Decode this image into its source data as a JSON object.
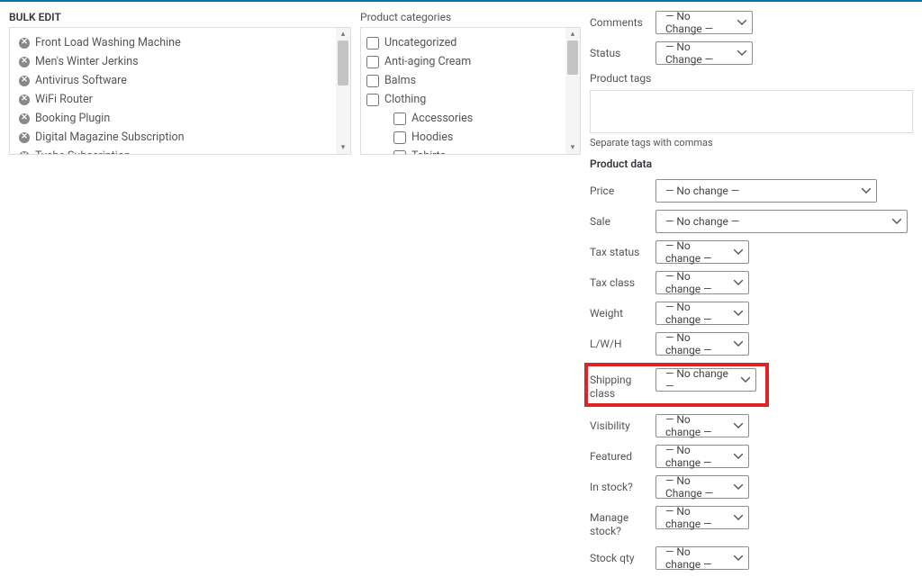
{
  "bulkEdit": {
    "title": "BULK EDIT",
    "items": [
      "Front Load Washing Machine",
      "Men's Winter Jerkins",
      "Antivirus Software",
      "WiFi Router",
      "Booking Plugin",
      "Digital Magazine Subscription",
      "Tyche Subscription"
    ]
  },
  "categories": {
    "title": "Product categories",
    "items": [
      {
        "label": "Uncategorized",
        "level": 0
      },
      {
        "label": "Anti-aging Cream",
        "level": 0
      },
      {
        "label": "Balms",
        "level": 0
      },
      {
        "label": "Clothing",
        "level": 0
      },
      {
        "label": "Accessories",
        "level": 1
      },
      {
        "label": "Hoodies",
        "level": 1
      },
      {
        "label": "Tshirts",
        "level": 1
      }
    ]
  },
  "right": {
    "comments": {
      "label": "Comments",
      "value": "— No Change —"
    },
    "status": {
      "label": "Status",
      "value": "— No Change —"
    },
    "tags": {
      "label": "Product tags",
      "hint": "Separate tags with commas"
    },
    "productData": {
      "label": "Product data"
    },
    "price": {
      "label": "Price",
      "value": "— No change —"
    },
    "sale": {
      "label": "Sale",
      "value": "— No change —"
    },
    "taxStatus": {
      "label": "Tax status",
      "value": "— No change —"
    },
    "taxClass": {
      "label": "Tax class",
      "value": "— No change —"
    },
    "weight": {
      "label": "Weight",
      "value": "— No change —"
    },
    "lwh": {
      "label": "L/W/H",
      "value": "— No change —"
    },
    "shipping": {
      "label": "Shipping class",
      "value": "— No change —"
    },
    "visibility": {
      "label": "Visibility",
      "value": "— No change —"
    },
    "featured": {
      "label": "Featured",
      "value": "— No change —"
    },
    "inStock": {
      "label": "In stock?",
      "value": "— No Change —"
    },
    "manageStock": {
      "label": "Manage stock?",
      "value": "— No change —"
    },
    "stockQty": {
      "label": "Stock qty",
      "value": "— No change —"
    }
  }
}
